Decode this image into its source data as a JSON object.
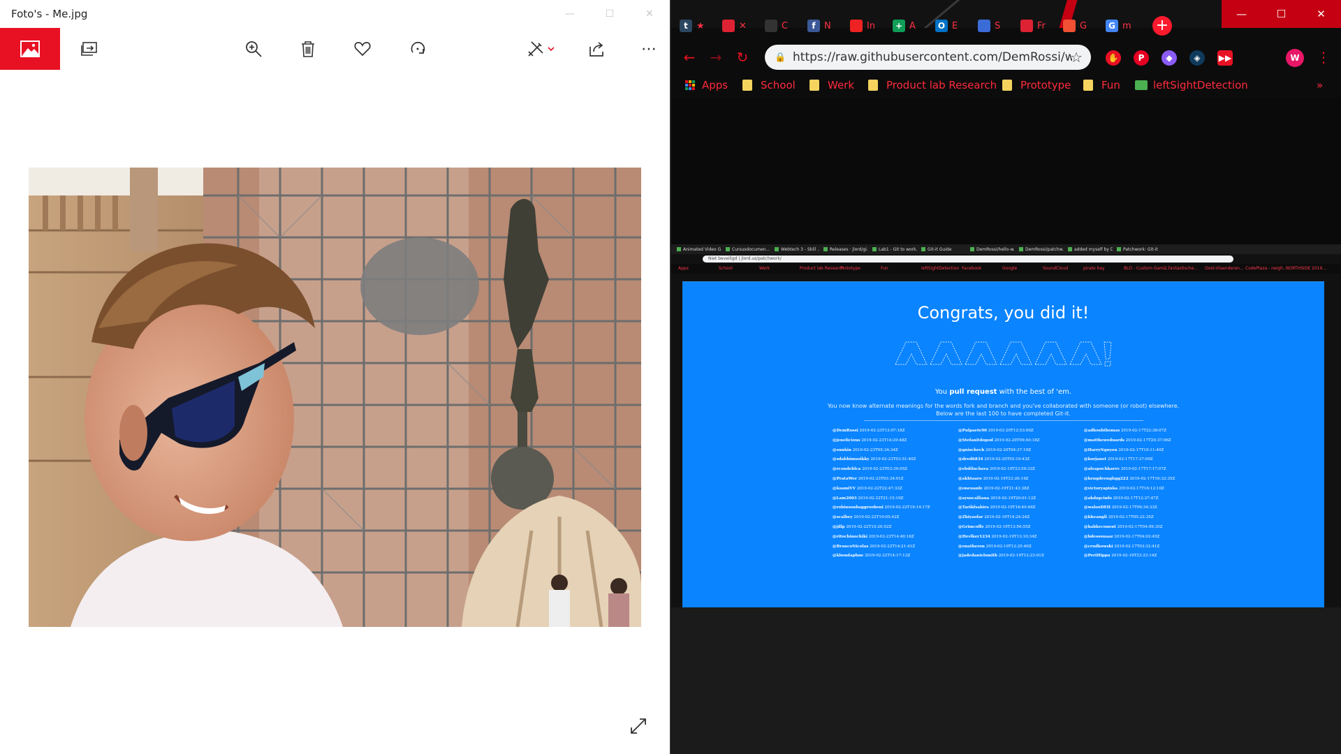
{
  "photos": {
    "title": "Foto's - Me.jpg",
    "toolbar_icons": [
      "photos-app-icon",
      "slideshow-icon",
      "zoom-in-icon",
      "delete-icon",
      "favorite-icon",
      "rotate-icon",
      "edit-create-icon",
      "share-icon",
      "more-icon"
    ],
    "more_label": "⋯",
    "colors": {
      "accent": "#e81123"
    }
  },
  "chrome": {
    "tabs": [
      {
        "favicon": "t",
        "label": "★",
        "color": "#2c4762"
      },
      {
        "favicon": "",
        "label": "✕",
        "color": "#d23"
      },
      {
        "favicon": "",
        "label": "C",
        "color": "#333"
      },
      {
        "favicon": "f",
        "label": "N",
        "color": "#3b5998"
      },
      {
        "favicon": "",
        "label": "In",
        "color": "#e22"
      },
      {
        "favicon": "+",
        "label": "A",
        "color": "#0f9d58"
      },
      {
        "favicon": "O",
        "label": "E",
        "color": "#0072c6"
      },
      {
        "favicon": "",
        "label": "S",
        "color": "#3b6bd6"
      },
      {
        "favicon": "",
        "label": "Fr",
        "color": "#d23"
      },
      {
        "favicon": "",
        "label": "G",
        "color": "#f05033"
      },
      {
        "favicon": "G",
        "label": "m",
        "color": "#4285f4"
      }
    ],
    "new_tab": "+",
    "url": "https://raw.githubusercontent.com/DemRossi/webt...",
    "bookmarks": [
      "Apps",
      "School",
      "Werk",
      "Product lab Research",
      "Prototype",
      "Fun",
      "leftSightDetection"
    ],
    "bookmarks_more": "»",
    "profile_initial": "W",
    "colors": {
      "accent": "#e81123",
      "theme_red": "#c40012"
    }
  },
  "shot": {
    "mini_tabs": [
      "Animated Video G...",
      "Cursusdocumen...",
      "Webtech 3 - Skill ...",
      "Releases · jlord/gi...",
      "Lab1 - Git to work...",
      "Git-it Guide",
      "DemRossi/hello-w...",
      "DemRossi/patchw...",
      "added myself by D...",
      "Patchwork: Git-it"
    ],
    "mini_url": "Niet beveiligd | jlord.us/patchwork/",
    "mini_bookmarks": [
      "Apps",
      "School",
      "Werk",
      "Product lab Research",
      "Prototype",
      "Fun",
      "leftSightDetection",
      "Facebook",
      "Google",
      "SoundCloud",
      "pirate bay",
      "BLO - Custom Gami...",
      "2 fantastische...",
      "Oost-Vlaanderen...",
      "CodePlaza - neigh...",
      "NORTHSIDE 2019..."
    ],
    "heading": "Congrats, you did it!",
    "sub1_pre": "You ",
    "sub1_bold": "pull request",
    "sub1_post": " with the best of 'em.",
    "sub2": "You now know alternate meanings for the words fork and branch and you've collaborated with someone (or robot) elsewhere. Below are the last 100 to have completed Git-it.",
    "col1": [
      [
        "@DemRossi",
        "2019-02-23T13:07:18Z"
      ],
      [
        "@jenelicious",
        "2019-02-23T14:29:48Z"
      ],
      [
        "@sunkin",
        "2019-02-23T05:34:34Z"
      ],
      [
        "@sdabhimuzikky",
        "2019-02-23T03:51:40Z"
      ],
      [
        "@rcondeblca",
        "2019-02-23T03:30:05Z"
      ],
      [
        "@PrataWer",
        "2019-02-23T03:34:01Z"
      ],
      [
        "@ksamiVV",
        "2019-02-22T22:47:33Z"
      ],
      [
        "@Lam2003",
        "2019-02-22T21:15:19Z"
      ],
      [
        "@robinsonbaggroobeni",
        "2019-02-22T19:14:17Z"
      ],
      [
        "@scalbey",
        "2019-02-22T19:05:42Z"
      ],
      [
        "@jdlp",
        "2019-02-22T15:20:52Z"
      ],
      [
        "@ritochinochiki",
        "2019-02-22T14:40:16Z"
      ],
      [
        "@BrancoNicolas",
        "2019-02-22T14:21:41Z"
      ],
      [
        "@kbondaphne",
        "2019-02-22T14:17:13Z"
      ]
    ],
    "col2": [
      [
        "@Pulpaete90",
        "2019-02-20T12:53:00Z"
      ],
      [
        "@Stefanitdopod",
        "2019-02-20T09:40:18Z"
      ],
      [
        "@gnischech",
        "2019-02-20T04:37:19Z"
      ],
      [
        "@dred6834",
        "2019-02-20T02:19:43Z"
      ],
      [
        "@ebdiluchava",
        "2019-02-19T23:59:32Z"
      ],
      [
        "@akhtaaro",
        "2019-02-19T23:26:14Z"
      ],
      [
        "@oneuanfe",
        "2019-02-19T21:43:38Z"
      ],
      [
        "@ayuscalliana",
        "2019-02-19T20:01:12Z"
      ],
      [
        "@Tarikfsahira",
        "2019-02-19T16:40:46Z"
      ],
      [
        "@Zhiyaofar",
        "2019-02-19T14:24:24Z"
      ],
      [
        "@Grimcoffe",
        "2019-02-19T13:56:55Z"
      ],
      [
        "@Hevlker1234",
        "2019-02-19T13:10:34Z"
      ],
      [
        "@onatheron",
        "2019-02-19T12:25:40Z"
      ],
      [
        "@jadedanielsmith",
        "2019-02-19T12:23:01Z"
      ]
    ],
    "col3": [
      [
        "@adhoshthomas",
        "2019-02-17T22:38:07Z"
      ],
      [
        "@mattheweduards",
        "2019-02-17T20:37:06Z"
      ],
      [
        "@HarryNguyen",
        "2019-02-17T19:11:40Z"
      ],
      [
        "@korjanet",
        "2019-02-17T17:37:09Z"
      ],
      [
        "@aleapochkarev",
        "2019-02-17T17:17:07Z"
      ],
      [
        "@kengdeenghgg222",
        "2019-02-17T16:32:35Z"
      ],
      [
        "@victoryapinka",
        "2019-02-17T16:12:10Z"
      ],
      [
        "@akdzgcinfo",
        "2019-02-17T12:27:47Z"
      ],
      [
        "@walooDEII",
        "2019-02-17T09:34:33Z"
      ],
      [
        "@kheangli",
        "2019-02-17T05:22:35Z"
      ],
      [
        "@kabkeconent",
        "2019-02-17T04:09:35Z"
      ],
      [
        "@bdessonaaz",
        "2019-02-17T04:02:45Z"
      ],
      [
        "@crudkowski",
        "2019-02-17T03:32:41Z"
      ],
      [
        "@PeriHippu",
        "2019-02-16T23:23:14Z"
      ]
    ]
  }
}
